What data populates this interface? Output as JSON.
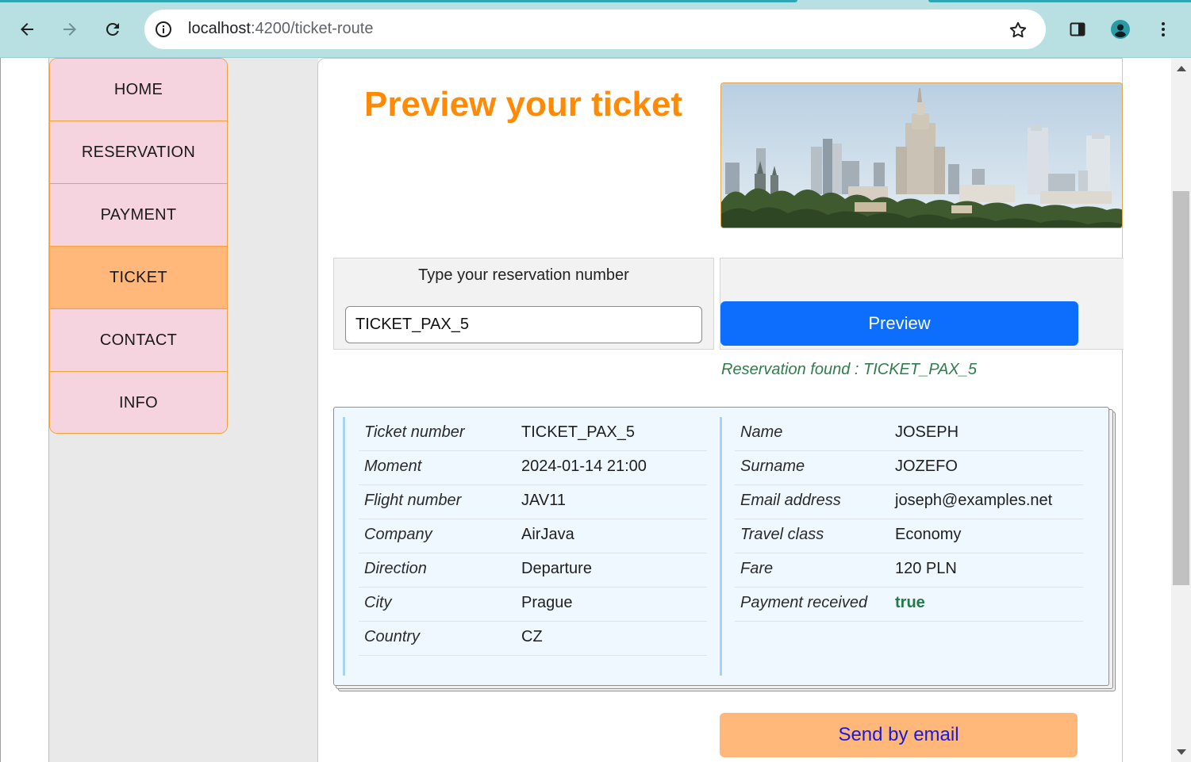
{
  "browser": {
    "url_host": "localhost",
    "url_path": ":4200/ticket-route"
  },
  "menu": {
    "items": [
      {
        "label": "HOME"
      },
      {
        "label": "RESERVATION"
      },
      {
        "label": "PAYMENT"
      },
      {
        "label": "TICKET",
        "active": true
      },
      {
        "label": "CONTACT"
      },
      {
        "label": "INFO"
      }
    ]
  },
  "page": {
    "title": "Preview your ticket",
    "search_label": "Type your reservation number",
    "search_value": "TICKET_PAX_5",
    "preview_button": "Preview",
    "status_message": "Reservation found : TICKET_PAX_5",
    "send_button": "Send by email"
  },
  "ticket": {
    "left": [
      {
        "key": "Ticket number",
        "value": "TICKET_PAX_5"
      },
      {
        "key": "Moment",
        "value": "2024-01-14 21:00"
      },
      {
        "key": "Flight number",
        "value": "JAV11"
      },
      {
        "key": "Company",
        "value": "AirJava"
      },
      {
        "key": "Direction",
        "value": "Departure"
      },
      {
        "key": "City",
        "value": "Prague"
      },
      {
        "key": "Country",
        "value": "CZ"
      }
    ],
    "right": [
      {
        "key": "Name",
        "value": "JOSEPH"
      },
      {
        "key": "Surname",
        "value": "JOZEFO"
      },
      {
        "key": "Email address",
        "value": "joseph@examples.net"
      },
      {
        "key": "Travel class",
        "value": "Economy"
      },
      {
        "key": "Fare",
        "value": "120 PLN"
      },
      {
        "key": "Payment received",
        "value": "true"
      }
    ]
  },
  "colors": {
    "title": "#ff8a05",
    "menu_bg": "#f5d4e0",
    "menu_active": "#ffb77a",
    "preview_button": "#0d6efd",
    "success_text": "#2e7d4a"
  }
}
